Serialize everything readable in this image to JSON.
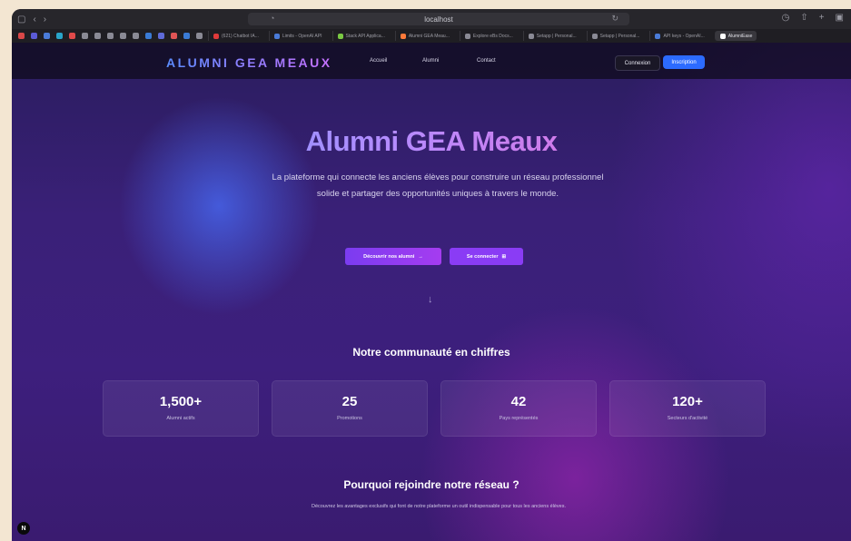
{
  "browser": {
    "url": "localhost",
    "bookmarks_colors": [
      "#d94848",
      "#5b5bd6",
      "#4a7bd8",
      "#2aa5c9",
      "#e04a4a",
      "#8a8a95",
      "#8a8a95",
      "#8a8a95",
      "#8a8a95",
      "#8a8a95",
      "#3a7bd5",
      "#5f6bd8",
      "#e05555",
      "#3a7bd5",
      "#8a8a95"
    ],
    "tabs": [
      {
        "label": "(621) Chatbot IA...",
        "color": "#e03a3a"
      },
      {
        "label": "Limits - OpenAI API",
        "color": "#4a7bd8"
      },
      {
        "label": "Stack API Applica...",
        "color": "#7ac943"
      },
      {
        "label": "Alumni GEA Meau...",
        "color": "#ff7a3a"
      },
      {
        "label": "Explore eBs Docs...",
        "color": "#8a8a95"
      },
      {
        "label": "Setapp | Personal...",
        "color": "#8a8a95"
      },
      {
        "label": "Setapp | Personal...",
        "color": "#8a8a95"
      },
      {
        "label": "API keys - OpenAI...",
        "color": "#4a7bd8"
      },
      {
        "label": "AlumniEase",
        "color": "#ffffff"
      }
    ]
  },
  "nav": {
    "logo": "ALUMNI GEA MEAUX",
    "links": [
      "Accueil",
      "Alumni",
      "Contact"
    ],
    "login": "Connexion",
    "signup": "Inscription"
  },
  "hero": {
    "title": "Alumni GEA Meaux",
    "subtitle": "La plateforme qui connecte les anciens élèves pour construire un réseau professionnel solide et partager des opportunités uniques à travers le monde.",
    "btn_discover": "Découvrir nos alumni",
    "btn_connect": "Se connecter"
  },
  "stats": {
    "title": "Notre communauté en chiffres",
    "items": [
      {
        "value": "1,500+",
        "label": "Alumni actifs"
      },
      {
        "value": "25",
        "label": "Promotions"
      },
      {
        "value": "42",
        "label": "Pays représentés"
      },
      {
        "value": "120+",
        "label": "Secteurs d'activité"
      }
    ]
  },
  "why": {
    "title": "Pourquoi rejoindre notre réseau ?",
    "subtitle": "Découvrez les avantages exclusifs qui font de notre plateforme un outil indispensable pour tous les anciens élèves."
  },
  "badge": "N"
}
